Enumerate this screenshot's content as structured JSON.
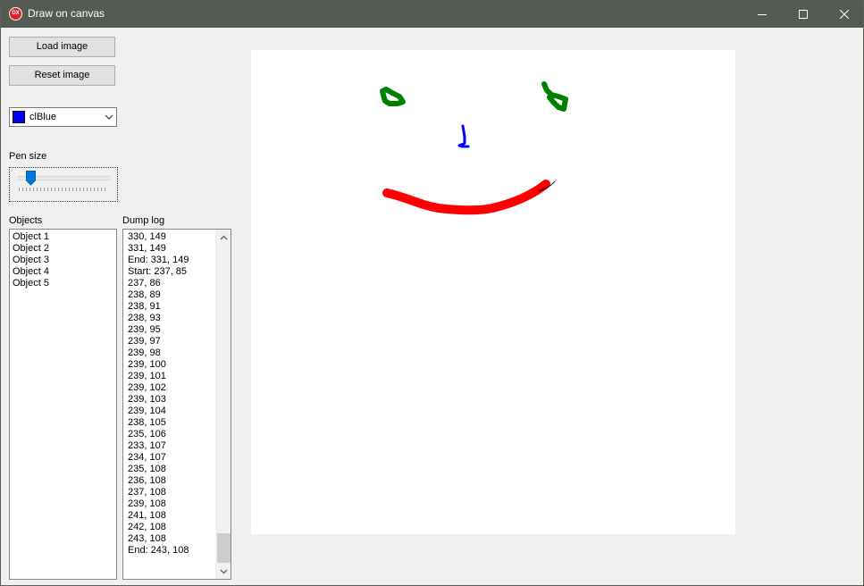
{
  "window": {
    "title": "Draw on canvas",
    "app_icon_text": "DX",
    "controls": [
      "minimize-icon",
      "maximize-icon",
      "close-icon"
    ]
  },
  "toolbar": {
    "load_label": "Load image",
    "reset_label": "Reset image"
  },
  "color_combo": {
    "selected": "clBlue",
    "swatch_color": "#0000ff"
  },
  "pen": {
    "label": "Pen size",
    "value_fraction": 0.1
  },
  "objects": {
    "label": "Objects",
    "items": [
      "Object 1",
      "Object 2",
      "Object 3",
      "Object 4",
      "Object 5"
    ]
  },
  "dump": {
    "label": "Dump log",
    "items": [
      "330, 149",
      "331, 149",
      "End: 331, 149",
      "Start: 237, 85",
      "237, 86",
      "238, 89",
      "238, 91",
      "238, 93",
      "239, 95",
      "239, 97",
      "239, 98",
      "239, 100",
      "239, 101",
      "239, 102",
      "239, 103",
      "239, 104",
      "238, 105",
      "235, 106",
      "233, 107",
      "234, 107",
      "235, 108",
      "236, 108",
      "237, 108",
      "239, 108",
      "241, 108",
      "242, 108",
      "243, 108",
      "End: 243, 108"
    ]
  },
  "drawing": {
    "stroke_colors": [
      "#008000",
      "#008000",
      "#0000ff",
      "#ff0000",
      "#000000"
    ]
  }
}
